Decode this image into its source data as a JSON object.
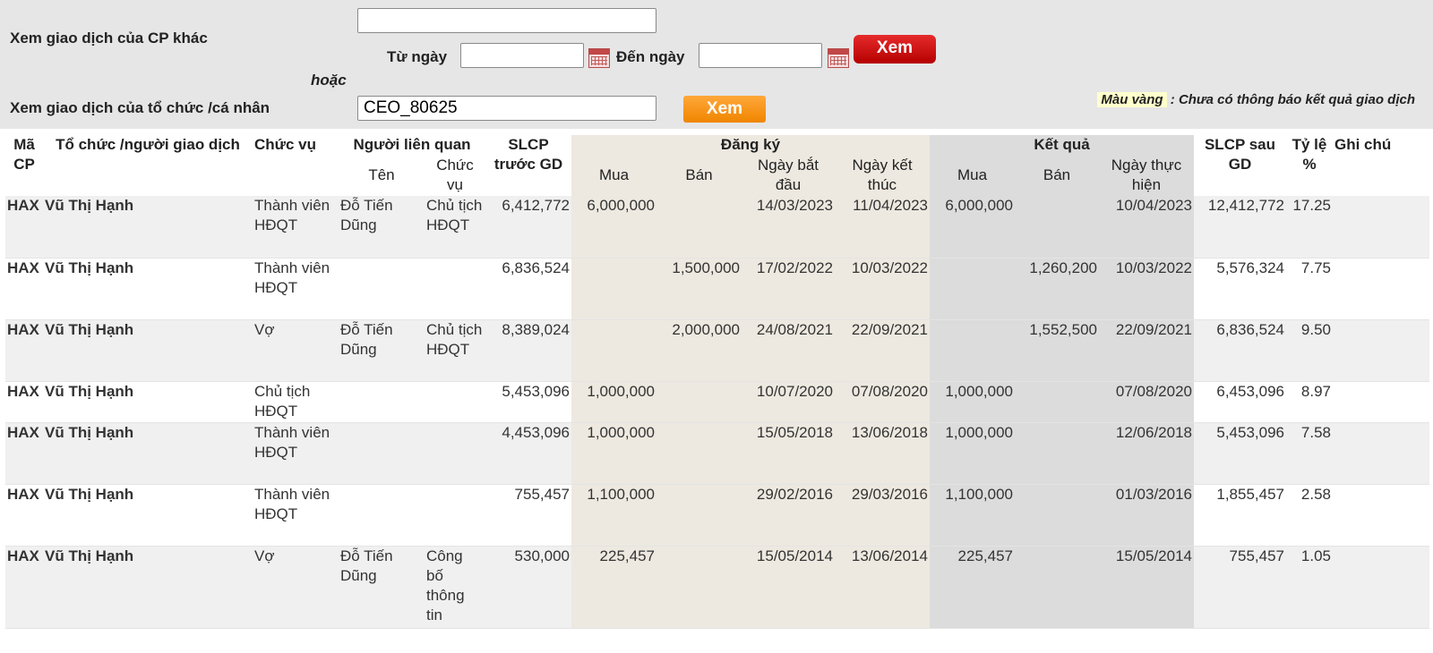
{
  "filters": {
    "other_stock_label": "Xem giao dịch của CP khác",
    "stock_code_value": "",
    "from_date_label": "Từ ngày",
    "from_date_value": "",
    "to_date_label": "Đến ngày",
    "to_date_value": "",
    "view_button": "Xem",
    "or_label": "hoặc",
    "person_label": "Xem giao dịch của tổ chức /cá nhân",
    "person_value": "CEO_80625",
    "view_person_button": "Xem",
    "legend_highlight": "Màu vàng",
    "legend_text": " : Chưa có thông báo kết quả giao dịch"
  },
  "colors": {
    "view_button": "#d00000",
    "view_person_button": "#f7941d",
    "legend_highlight": "#ffffcc",
    "registration_column": "#ede9e0",
    "result_column": "#dcdcdc"
  },
  "table": {
    "headers": {
      "code": "Mã CP",
      "party": "Tổ chức /người giao dịch",
      "position": "Chức vụ",
      "related": "Người liên quan",
      "related_name": "Tên",
      "related_position": "Chức vụ",
      "before": "SLCP trước GD",
      "registration": "Đăng ký",
      "reg_buy": "Mua",
      "reg_sell": "Bán",
      "reg_start": "Ngày bắt đầu",
      "reg_end": "Ngày kết thúc",
      "result": "Kết quả",
      "res_buy": "Mua",
      "res_sell": "Bán",
      "res_date": "Ngày thực hiện",
      "after": "SLCP sau GD",
      "ratio": "Tỷ lệ %",
      "note": "Ghi chú"
    },
    "rows": [
      {
        "code": "HAX",
        "party": "Vũ Thị Hạnh",
        "position": "Thành viên HĐQT",
        "rel_name": "Đỗ Tiến Dũng",
        "rel_position": "Chủ tịch HĐQT",
        "before": "6,412,772",
        "reg_buy": "6,000,000",
        "reg_sell": "",
        "reg_start": "14/03/2023",
        "reg_end": "11/04/2023",
        "res_buy": "6,000,000",
        "res_sell": "",
        "res_date": "10/04/2023",
        "after": "12,412,772",
        "ratio": "17.25",
        "note": ""
      },
      {
        "code": "HAX",
        "party": "Vũ Thị Hạnh",
        "position": "Thành viên HĐQT",
        "rel_name": "",
        "rel_position": "",
        "before": "6,836,524",
        "reg_buy": "",
        "reg_sell": "1,500,000",
        "reg_start": "17/02/2022",
        "reg_end": "10/03/2022",
        "res_buy": "",
        "res_sell": "1,260,200",
        "res_date": "10/03/2022",
        "after": "5,576,324",
        "ratio": "7.75",
        "note": ""
      },
      {
        "code": "HAX",
        "party": "Vũ Thị Hạnh",
        "position": "Vợ",
        "rel_name": "Đỗ Tiến Dũng",
        "rel_position": "Chủ tịch HĐQT",
        "before": "8,389,024",
        "reg_buy": "",
        "reg_sell": "2,000,000",
        "reg_start": "24/08/2021",
        "reg_end": "22/09/2021",
        "res_buy": "",
        "res_sell": "1,552,500",
        "res_date": "22/09/2021",
        "after": "6,836,524",
        "ratio": "9.50",
        "note": ""
      },
      {
        "code": "HAX",
        "party": "Vũ Thị Hạnh",
        "position": "Chủ tịch HĐQT",
        "rel_name": "",
        "rel_position": "",
        "before": "5,453,096",
        "reg_buy": "1,000,000",
        "reg_sell": "",
        "reg_start": "10/07/2020",
        "reg_end": "07/08/2020",
        "res_buy": "1,000,000",
        "res_sell": "",
        "res_date": "07/08/2020",
        "after": "6,453,096",
        "ratio": "8.97",
        "note": ""
      },
      {
        "code": "HAX",
        "party": "Vũ Thị Hạnh",
        "position": "Thành viên HĐQT",
        "rel_name": "",
        "rel_position": "",
        "before": "4,453,096",
        "reg_buy": "1,000,000",
        "reg_sell": "",
        "reg_start": "15/05/2018",
        "reg_end": "13/06/2018",
        "res_buy": "1,000,000",
        "res_sell": "",
        "res_date": "12/06/2018",
        "after": "5,453,096",
        "ratio": "7.58",
        "note": ""
      },
      {
        "code": "HAX",
        "party": "Vũ Thị Hạnh",
        "position": "Thành viên HĐQT",
        "rel_name": "",
        "rel_position": "",
        "before": "755,457",
        "reg_buy": "1,100,000",
        "reg_sell": "",
        "reg_start": "29/02/2016",
        "reg_end": "29/03/2016",
        "res_buy": "1,100,000",
        "res_sell": "",
        "res_date": "01/03/2016",
        "after": "1,855,457",
        "ratio": "2.58",
        "note": ""
      },
      {
        "code": "HAX",
        "party": "Vũ Thị Hạnh",
        "position": "Vợ",
        "rel_name": "Đỗ Tiến Dũng",
        "rel_position": "Công bố thông tin",
        "before": "530,000",
        "reg_buy": "225,457",
        "reg_sell": "",
        "reg_start": "15/05/2014",
        "reg_end": "13/06/2014",
        "res_buy": "225,457",
        "res_sell": "",
        "res_date": "15/05/2014",
        "after": "755,457",
        "ratio": "1.05",
        "note": ""
      }
    ]
  }
}
